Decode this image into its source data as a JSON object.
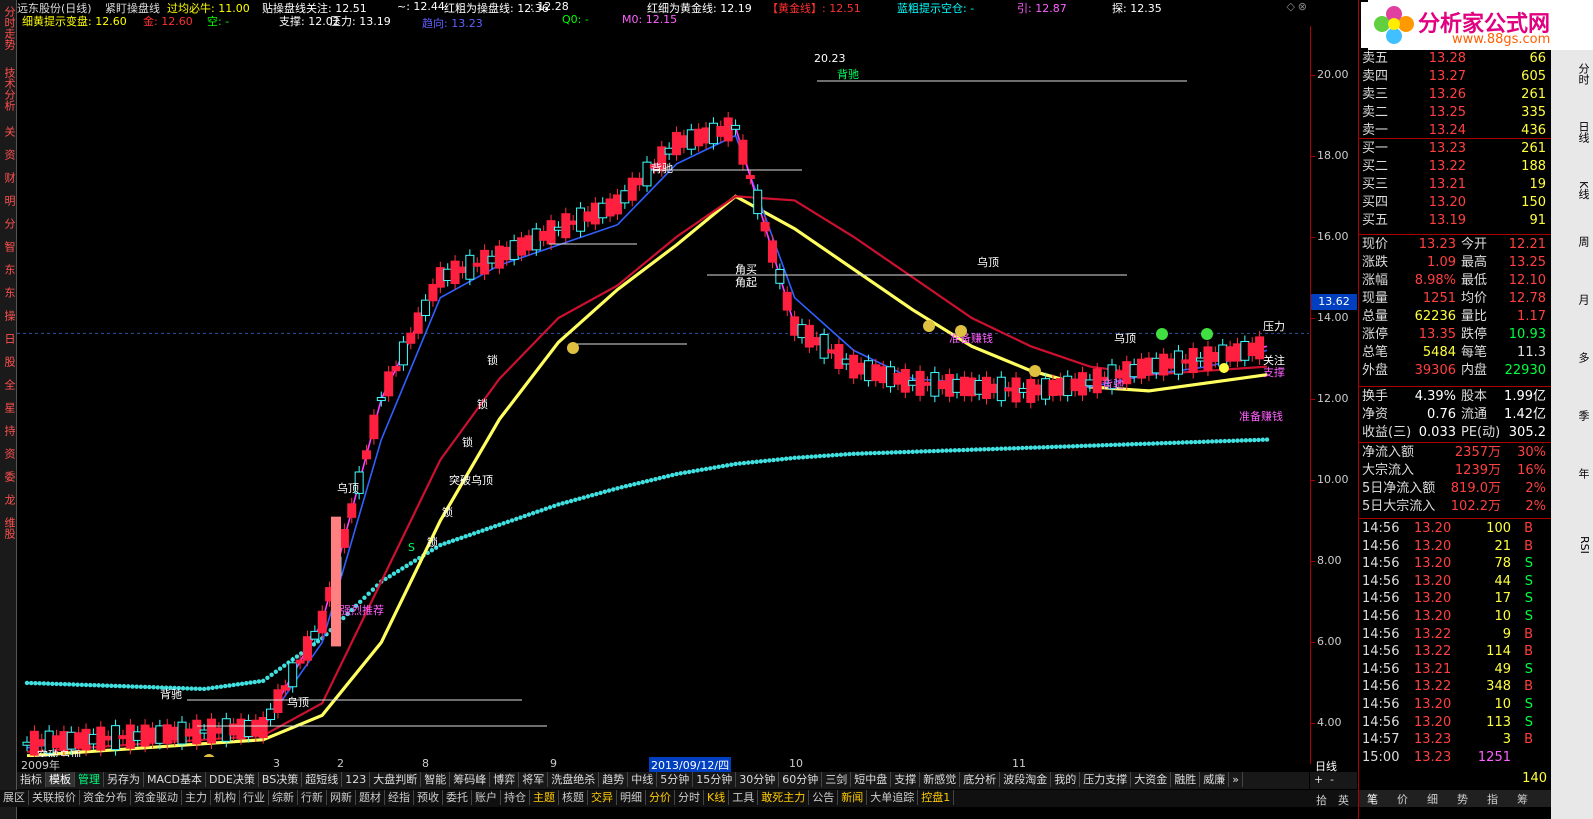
{
  "window": {
    "title": "远东股份(日线)"
  },
  "indicators_row1": [
    {
      "text": "远东股份(日线)",
      "color": "#dddddd"
    },
    {
      "text": "紧盯操盘线",
      "color": "#dddddd"
    },
    {
      "text": "过均必牛: 11.00",
      "color": "#ffff00"
    },
    {
      "text": "贴操盘线关注: 12.51",
      "color": "#ffffff"
    },
    {
      "text": "~: 12.44",
      "color": "#ffffff"
    },
    {
      "text": "红粗为操盘线: 12.36",
      "color": "#ffffff"
    },
    {
      "text": ": 12.28",
      "color": "#ffffff"
    },
    {
      "text": "红细为黄金线: 12.19",
      "color": "#ffffff"
    },
    {
      "text": "【黄金线】: 12.51",
      "color": "#ff3030"
    },
    {
      "text": "蓝粗提示空仓: -",
      "color": "#00ffff"
    },
    {
      "text": "引: 12.87",
      "color": "#ff60ff"
    },
    {
      "text": "探: 12.35",
      "color": "#ffffff"
    }
  ],
  "indicators_row2": [
    {
      "text": "细黄提示变盘: 12.60",
      "color": "#ffff00"
    },
    {
      "text": "金: 12.60",
      "color": "#ff3030"
    },
    {
      "text": "空: -",
      "color": "#00ff00"
    },
    {
      "text": "支撑: 12.02",
      "color": "#ffffff"
    },
    {
      "text": "压力: 13.19",
      "color": "#ffffff"
    },
    {
      "text": "Q0: -",
      "color": "#00ff00"
    },
    {
      "text": "M0: 12.15",
      "color": "#ff60ff"
    }
  ],
  "indicators_row3": [
    {
      "text": "趋向: 13.23",
      "color": "#6060ff"
    }
  ],
  "left_sidebar": [
    "分时走势",
    "技术分析",
    "关",
    "资",
    "财",
    "明",
    "分",
    "智",
    "东",
    "东",
    "操",
    "日",
    "股",
    "全",
    "星",
    "持",
    "资",
    "委",
    "龙",
    "维股"
  ],
  "price_axis": {
    "ticks": [
      "20.00",
      "18.00",
      "16.00",
      "14.00",
      "12.00",
      "10.00",
      "8.00",
      "6.00",
      "4.00"
    ],
    "current": "13.62",
    "period": "日线"
  },
  "x_labels": [
    "2009年",
    "3",
    "2",
    "8",
    "9",
    "2013/09/12/四",
    "10",
    "11"
  ],
  "chart_labels": {
    "high": "20.23",
    "beichi": [
      "背驰",
      "背驰",
      "背驰",
      "背驰"
    ],
    "wuding": [
      "乌顶",
      "乌顶",
      "乌顶",
      "乌顶"
    ],
    "misc": [
      "角买",
      "角起",
      "强烈推荐",
      "准备赚钱",
      "准备赚钱",
      "锁",
      "锁",
      "锁",
      "锁",
      "锁",
      "突破乌顶",
      "角买",
      "压力",
      "关注",
      "支撑",
      "突破乌顶",
      "S"
    ]
  },
  "quote": {
    "sell": [
      {
        "label": "卖五",
        "price": "13.28",
        "vol": "66"
      },
      {
        "label": "卖四",
        "price": "13.27",
        "vol": "605"
      },
      {
        "label": "卖三",
        "price": "13.26",
        "vol": "261"
      },
      {
        "label": "卖二",
        "price": "13.25",
        "vol": "335"
      },
      {
        "label": "卖一",
        "price": "13.24",
        "vol": "436"
      }
    ],
    "buy": [
      {
        "label": "买一",
        "price": "13.23",
        "vol": "261"
      },
      {
        "label": "买二",
        "price": "13.22",
        "vol": "188"
      },
      {
        "label": "买三",
        "price": "13.21",
        "vol": "19"
      },
      {
        "label": "买四",
        "price": "13.20",
        "vol": "150"
      },
      {
        "label": "买五",
        "price": "13.19",
        "vol": "91"
      }
    ],
    "stats": [
      {
        "l1": "现价",
        "v1": "13.23",
        "l2": "今开",
        "v2": "12.21"
      },
      {
        "l1": "涨跌",
        "v1": "1.09",
        "l2": "最高",
        "v2": "13.25"
      },
      {
        "l1": "涨幅",
        "v1": "8.98%",
        "l2": "最低",
        "v2": "12.10"
      },
      {
        "l1": "现量",
        "v1": "1251",
        "l2": "均价",
        "v2": "12.78"
      },
      {
        "l1": "总量",
        "v1": "62236",
        "l2": "量比",
        "v2": "1.17"
      },
      {
        "l1": "涨停",
        "v1": "13.35",
        "l2": "跌停",
        "v2": "10.93"
      },
      {
        "l1": "总笔",
        "v1": "5484",
        "l2": "每笔",
        "v2": "11.3"
      },
      {
        "l1": "外盘",
        "v1": "39306",
        "l2": "内盘",
        "v2": "22930"
      }
    ],
    "fund": [
      {
        "l1": "换手",
        "v1": "4.39%",
        "l2": "股本",
        "v2": "1.99亿"
      },
      {
        "l1": "净资",
        "v1": "0.76",
        "l2": "流通",
        "v2": "1.42亿"
      },
      {
        "l1": "收益(三)",
        "v1": "0.033",
        "l2": "PE(动)",
        "v2": "305.2"
      }
    ],
    "flow": [
      {
        "l": "净流入额",
        "v": "2357万",
        "p": "30%"
      },
      {
        "l": "大宗流入",
        "v": "1239万",
        "p": "16%"
      },
      {
        "l": "5日净流入额",
        "v": "819.0万",
        "p": "2%"
      },
      {
        "l": "5日大宗流入",
        "v": "102.2万",
        "p": "2%"
      }
    ],
    "ticks": [
      {
        "t": "14:56",
        "p": "13.20",
        "v": "100",
        "d": "B"
      },
      {
        "t": "14:56",
        "p": "13.20",
        "v": "21",
        "d": "B"
      },
      {
        "t": "14:56",
        "p": "13.20",
        "v": "78",
        "d": "S"
      },
      {
        "t": "14:56",
        "p": "13.20",
        "v": "44",
        "d": "S"
      },
      {
        "t": "14:56",
        "p": "13.20",
        "v": "17",
        "d": "S"
      },
      {
        "t": "14:56",
        "p": "13.20",
        "v": "10",
        "d": "S"
      },
      {
        "t": "14:56",
        "p": "13.22",
        "v": "9",
        "d": "B"
      },
      {
        "t": "14:56",
        "p": "13.22",
        "v": "114",
        "d": "B"
      },
      {
        "t": "14:56",
        "p": "13.21",
        "v": "49",
        "d": "S"
      },
      {
        "t": "14:56",
        "p": "13.22",
        "v": "348",
        "d": "B"
      },
      {
        "t": "14:56",
        "p": "13.20",
        "v": "10",
        "d": "S"
      },
      {
        "t": "14:56",
        "p": "13.20",
        "v": "113",
        "d": "S"
      },
      {
        "t": "14:57",
        "p": "13.23",
        "v": "3",
        "d": "B"
      },
      {
        "t": "15:00",
        "p": "13.23",
        "v": "1251",
        "d": ""
      }
    ],
    "bottom_tabs": [
      "笔",
      "价",
      "细",
      "势",
      "指",
      "筹"
    ],
    "last_vol": "140"
  },
  "logo": {
    "title": "分析家公式网",
    "url": "www.88gs.com"
  },
  "right_toolbar": [
    "分时",
    "日线",
    "K线",
    "周",
    "月",
    "多",
    "季",
    "年",
    "RSI"
  ],
  "tabs1": [
    "指标",
    "模板",
    "管理",
    "另存为",
    "MACD基本",
    "DDE决策",
    "BS决策",
    "超短线",
    "123",
    "大盘判断",
    "智能",
    "筹码峰",
    "博弈",
    "将军",
    "洗盘绝杀",
    "趋势",
    "中线",
    "5分钟",
    "15分钟",
    "30分钟",
    "60分钟",
    "三剑",
    "短中盘",
    "支撑",
    "新感觉",
    "底分析",
    "波段淘金",
    "我的",
    "压力支撑",
    "大资金",
    "融胜",
    "威廉",
    "»"
  ],
  "tabs2": [
    "展区",
    "关联报价",
    "资金分布",
    "资金驱动",
    "主力",
    "机构",
    "行业",
    "综新",
    "行新",
    "网新",
    "题材",
    "经指",
    "预收",
    "委托",
    "账户",
    "持仓",
    "主题",
    "核题",
    "交异",
    "明细",
    "分价",
    "分时",
    "K线",
    "工具",
    "敢死主力",
    "公告",
    "新闻",
    "大单追踪",
    "控盘1"
  ],
  "tab_controls": [
    "+",
    "-",
    "拾",
    "英"
  ],
  "chart_data": {
    "type": "line",
    "title": "",
    "xlabel": "",
    "ylabel": "",
    "ylim": [
      3.0,
      21.2
    ],
    "grid": false,
    "series": [
      {
        "values": [
          5.0,
          4.95,
          4.9,
          4.85,
          5.05,
          6.1,
          7.5,
          8.4,
          8.9,
          9.4,
          9.8,
          10.15,
          10.4,
          10.55,
          10.65,
          10.7,
          10.75,
          10.8,
          10.85,
          10.9,
          10.95,
          11.0
        ]
      },
      {
        "values": [
          3.2,
          3.3,
          3.4,
          3.5,
          3.6,
          4.2,
          6.0,
          9.0,
          11.5,
          13.4,
          14.7,
          15.8,
          17.0,
          16.2,
          15.2,
          14.2,
          13.3,
          12.7,
          12.3,
          12.2,
          12.4,
          12.6
        ]
      },
      {
        "values": [
          3.4,
          3.6,
          3.7,
          3.8,
          3.9,
          6.0,
          11.0,
          14.5,
          15.3,
          15.8,
          16.3,
          17.8,
          18.5,
          14.5,
          13.2,
          12.5,
          12.4,
          12.2,
          12.3,
          12.6,
          12.8,
          13.2
        ]
      },
      {
        "values": [
          3.3,
          3.4,
          3.5,
          3.6,
          3.7,
          4.5,
          7.5,
          10.5,
          12.5,
          14.0,
          14.8,
          16.0,
          17.0,
          16.9,
          16.0,
          15.0,
          14.0,
          13.3,
          12.8,
          12.6,
          12.7,
          12.8
        ]
      },
      {
        "values": [
          3.5,
          3.6,
          3.7,
          3.8,
          3.9,
          6.5,
          12.0,
          15.0,
          15.5,
          16.2,
          16.8,
          18.3,
          18.7,
          13.8,
          12.8,
          12.4,
          12.3,
          12.2,
          12.4,
          12.8,
          13.0,
          13.3
        ]
      }
    ]
  }
}
